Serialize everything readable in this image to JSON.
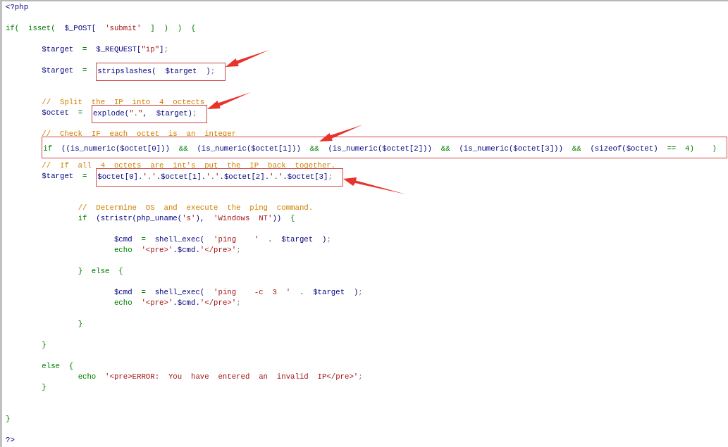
{
  "editor": {
    "lines": [
      {
        "kind": "code",
        "tokens": [
          {
            "kind": "code",
            "text": "<?php"
          }
        ]
      },
      {
        "kind": "blank"
      },
      {
        "kind": "code",
        "tokens": [
          {
            "kind": "keyword",
            "text": "if(  isset(  "
          },
          {
            "kind": "code",
            "text": "$_POST[  "
          },
          {
            "kind": "string",
            "text": "'submit'"
          },
          {
            "kind": "keyword",
            "text": "  ]  )  )  {"
          }
        ]
      },
      {
        "kind": "blank"
      },
      {
        "kind": "code",
        "tokens": [
          {
            "kind": "code",
            "text": "        $target  "
          },
          {
            "kind": "keyword",
            "text": "=  "
          },
          {
            "kind": "code",
            "text": "$_REQUEST["
          },
          {
            "kind": "string",
            "text": "\"ip\""
          },
          {
            "kind": "code",
            "text": "]"
          },
          {
            "kind": "punct",
            "text": ";"
          }
        ]
      },
      {
        "kind": "blank"
      },
      {
        "kind": "code",
        "tokens": [
          {
            "kind": "code",
            "text": "        $target  "
          },
          {
            "kind": "keyword",
            "text": "="
          },
          {
            "kind": "box",
            "tokens": [
              {
                "kind": "code",
                "text": "  stripslashes(  $target  )"
              },
              {
                "kind": "punct",
                "text": ";"
              }
            ]
          },
          {
            "kind": "arrow"
          }
        ]
      },
      {
        "kind": "blank"
      },
      {
        "kind": "blank"
      },
      {
        "kind": "code",
        "tokens": [
          {
            "kind": "comment",
            "text": "        //  Split  the  IP  into  4  octects"
          }
        ]
      },
      {
        "kind": "code",
        "tokens": [
          {
            "kind": "code",
            "text": "        $octet  "
          },
          {
            "kind": "keyword",
            "text": "=  "
          },
          {
            "kind": "box",
            "tokens": [
              {
                "kind": "code",
                "text": "explode("
              },
              {
                "kind": "string",
                "text": "\".\""
              },
              {
                "kind": "code",
                "text": ",  $target)"
              },
              {
                "kind": "punct",
                "text": ";"
              }
            ]
          },
          {
            "kind": "arrow"
          }
        ]
      },
      {
        "kind": "blank"
      },
      {
        "kind": "code",
        "tokens": [
          {
            "kind": "comment",
            "text": "        //  Check  IF  each  octet  is  an  integer"
          }
        ]
      },
      {
        "kind": "code",
        "tokens": [
          {
            "kind": "box",
            "tokens": [
              {
                "kind": "keyword",
                "text": "        if  "
              },
              {
                "kind": "code",
                "text": "((is_numeric($octet[0]))"
              },
              {
                "kind": "keyword",
                "text": "  &&  "
              },
              {
                "kind": "code",
                "text": "(is_numeric($octet[1]))"
              },
              {
                "kind": "keyword",
                "text": "  &&"
              },
              {
                "kind": "arrow"
              },
              {
                "kind": "code",
                "text": "  (is_numeric($octet[2]))"
              },
              {
                "kind": "keyword",
                "text": "  &&  "
              },
              {
                "kind": "code",
                "text": "(is_numeric($octet[3]))"
              },
              {
                "kind": "keyword",
                "text": "  &&  "
              },
              {
                "kind": "code",
                "text": "(sizeof($octet)"
              },
              {
                "kind": "keyword",
                "text": "  ==  4)    )"
              }
            ]
          }
        ]
      },
      {
        "kind": "blank"
      },
      {
        "kind": "code",
        "tokens": [
          {
            "kind": "comment",
            "text": "        //  If  all  4  octets  are  int's  put  the  IP  back  together."
          }
        ]
      },
      {
        "kind": "code",
        "tokens": [
          {
            "kind": "code",
            "text": "        $target  "
          },
          {
            "kind": "keyword",
            "text": "="
          },
          {
            "kind": "box",
            "tokens": [
              {
                "kind": "code",
                "text": "  $octet[0]."
              },
              {
                "kind": "string",
                "text": "'.'"
              },
              {
                "kind": "code",
                "text": ".$octet[1]."
              },
              {
                "kind": "string",
                "text": "'.'"
              },
              {
                "kind": "code",
                "text": ".$octet[2]."
              },
              {
                "kind": "string",
                "text": "'.'"
              },
              {
                "kind": "code",
                "text": ".$octet[3]"
              },
              {
                "kind": "punct",
                "text": ";"
              }
            ]
          },
          {
            "kind": "uparrow"
          }
        ]
      },
      {
        "kind": "blank"
      },
      {
        "kind": "blank"
      },
      {
        "kind": "code",
        "tokens": [
          {
            "kind": "comment",
            "text": "                //  Determine  OS  and  execute  the  ping  command."
          }
        ]
      },
      {
        "kind": "code",
        "tokens": [
          {
            "kind": "keyword",
            "text": "                if  "
          },
          {
            "kind": "code",
            "text": "(stristr(php_uname("
          },
          {
            "kind": "string",
            "text": "'s'"
          },
          {
            "kind": "code",
            "text": "),  "
          },
          {
            "kind": "string",
            "text": "'Windows  NT'"
          },
          {
            "kind": "code",
            "text": "))  "
          },
          {
            "kind": "keyword",
            "text": "{"
          }
        ]
      },
      {
        "kind": "blank"
      },
      {
        "kind": "code",
        "tokens": [
          {
            "kind": "code",
            "text": "                        $cmd  "
          },
          {
            "kind": "keyword",
            "text": "=  "
          },
          {
            "kind": "code",
            "text": "shell_exec(  "
          },
          {
            "kind": "string",
            "text": "'ping    '"
          },
          {
            "kind": "code",
            "text": "  .  $target  )"
          },
          {
            "kind": "punct",
            "text": ";"
          }
        ]
      },
      {
        "kind": "code",
        "tokens": [
          {
            "kind": "keyword",
            "text": "                        echo  "
          },
          {
            "kind": "string",
            "text": "'<pre>'"
          },
          {
            "kind": "code",
            "text": ".$cmd."
          },
          {
            "kind": "string",
            "text": "'</pre>'"
          },
          {
            "kind": "punct",
            "text": ";"
          }
        ]
      },
      {
        "kind": "blank"
      },
      {
        "kind": "code",
        "tokens": [
          {
            "kind": "keyword",
            "text": "                }  else  {"
          }
        ]
      },
      {
        "kind": "blank"
      },
      {
        "kind": "code",
        "tokens": [
          {
            "kind": "code",
            "text": "                        $cmd  "
          },
          {
            "kind": "keyword",
            "text": "=  "
          },
          {
            "kind": "code",
            "text": "shell_exec(  "
          },
          {
            "kind": "string",
            "text": "'ping    -c  3  '"
          },
          {
            "kind": "code",
            "text": "  .  $target  )"
          },
          {
            "kind": "punct",
            "text": ";"
          }
        ]
      },
      {
        "kind": "code",
        "tokens": [
          {
            "kind": "keyword",
            "text": "                        echo  "
          },
          {
            "kind": "string",
            "text": "'<pre>'"
          },
          {
            "kind": "code",
            "text": ".$cmd."
          },
          {
            "kind": "string",
            "text": "'</pre>'"
          },
          {
            "kind": "punct",
            "text": ";"
          }
        ]
      },
      {
        "kind": "blank"
      },
      {
        "kind": "code",
        "tokens": [
          {
            "kind": "keyword",
            "text": "                }"
          }
        ]
      },
      {
        "kind": "blank"
      },
      {
        "kind": "code",
        "tokens": [
          {
            "kind": "keyword",
            "text": "        }"
          }
        ]
      },
      {
        "kind": "blank"
      },
      {
        "kind": "code",
        "tokens": [
          {
            "kind": "keyword",
            "text": "        else  {"
          }
        ]
      },
      {
        "kind": "code",
        "tokens": [
          {
            "kind": "keyword",
            "text": "                echo  "
          },
          {
            "kind": "string",
            "text": "'<pre>ERROR:  You  have  entered  an  invalid  IP</pre>'"
          },
          {
            "kind": "punct",
            "text": ";"
          }
        ]
      },
      {
        "kind": "code",
        "tokens": [
          {
            "kind": "keyword",
            "text": "        }"
          }
        ]
      },
      {
        "kind": "blank"
      },
      {
        "kind": "blank"
      },
      {
        "kind": "code",
        "tokens": [
          {
            "kind": "keyword",
            "text": "}"
          }
        ]
      },
      {
        "kind": "blank"
      },
      {
        "kind": "code",
        "tokens": [
          {
            "kind": "code",
            "text": "?>"
          }
        ]
      }
    ]
  }
}
